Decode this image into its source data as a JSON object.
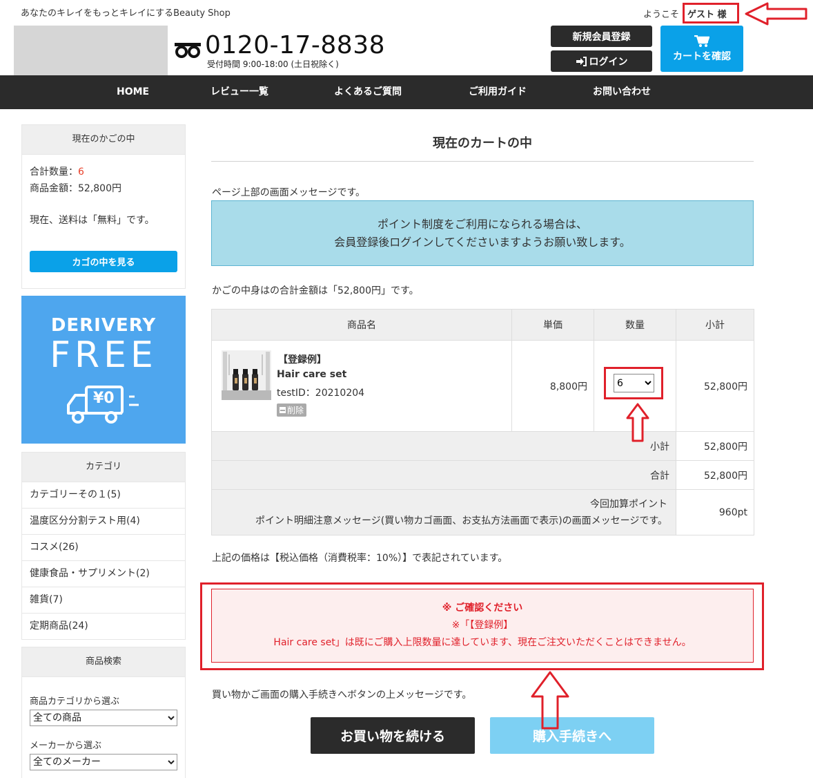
{
  "header": {
    "tagline": "あなたのキレイをもっとキレイにするBeauty Shop",
    "welcome": "ようこそ",
    "guest": "ゲスト 様",
    "phone_number": "0120-17-8838",
    "phone_hours": "受付時間 9:00-18:00 (土日祝除く)",
    "register_label": "新規会員登録",
    "login_label": "ログイン",
    "cart_label": "カートを確認"
  },
  "nav": {
    "items": [
      "HOME",
      "レビュー一覧",
      "よくあるご質問",
      "ご利用ガイド",
      "お問い合わせ"
    ]
  },
  "sidebar": {
    "basket_title": "現在のかごの中",
    "qty_label": "合計数量：",
    "qty_value": "6",
    "amount_label": "商品金額：52,800円",
    "shipping_text": "現在、送料は「無料」です。",
    "basket_button": "カゴの中を見る",
    "banner_line1": "DERIVERY",
    "banner_line2": "FREE",
    "banner_yen": "¥0",
    "category_title": "カテゴリ",
    "categories": [
      "カテゴリーその１(5)",
      "温度区分分割テスト用(4)",
      "コスメ(26)",
      "健康食品・サプリメント(2)",
      "雑貨(7)",
      "定期商品(24)"
    ],
    "search_title": "商品検索",
    "search_category_label": "商品カテゴリから選ぶ",
    "search_category_value": "全ての商品",
    "search_maker_label": "メーカーから選ぶ",
    "search_maker_value": "全てのメーカー"
  },
  "main": {
    "title": "現在のカートの中",
    "top_message": "ページ上部の画面メッセージです。",
    "info_line1": "ポイント制度をご利用になられる場合は、",
    "info_line2": "会員登録後ログインしてくださいますようお願い致します。",
    "total_message": "かごの中身はの合計金額は「52,800円」です。",
    "table": {
      "headers": [
        "商品名",
        "単価",
        "数量",
        "小計"
      ],
      "item_tag": "【登録例】",
      "item_name": "Hair care set",
      "item_id": "testID：20210204",
      "delete_label": "削除",
      "unit_price": "8,800円",
      "quantity": "6",
      "line_subtotal": "52,800円",
      "subtotal_label": "小計",
      "subtotal_value": "52,800円",
      "total_label": "合計",
      "total_value": "52,800円",
      "points_label": "今回加算ポイント",
      "points_note": "ポイント明細注意メッセージ(買い物カゴ画面、お支払方法画面で表示)の画面メッセージです。",
      "points_value": "960pt"
    },
    "tax_note": "上記の価格は【税込価格（消費税率：10%）】で表記されています。",
    "alert_title": "※ ご確認ください",
    "alert_line1": "※「【登録例】",
    "alert_line2": "Hair care set」は既にご購入上限数量に達しています、現在ご注文いただくことはできません。",
    "button_message": "買い物かご画面の購入手続きへボタンの上メッセージです。",
    "continue_label": "お買い物を続ける",
    "checkout_label": "購入手続きへ"
  },
  "colors": {
    "accent_blue": "#0aa1e8",
    "dark": "#2b2b2b",
    "annotation_red": "#e0202a"
  }
}
